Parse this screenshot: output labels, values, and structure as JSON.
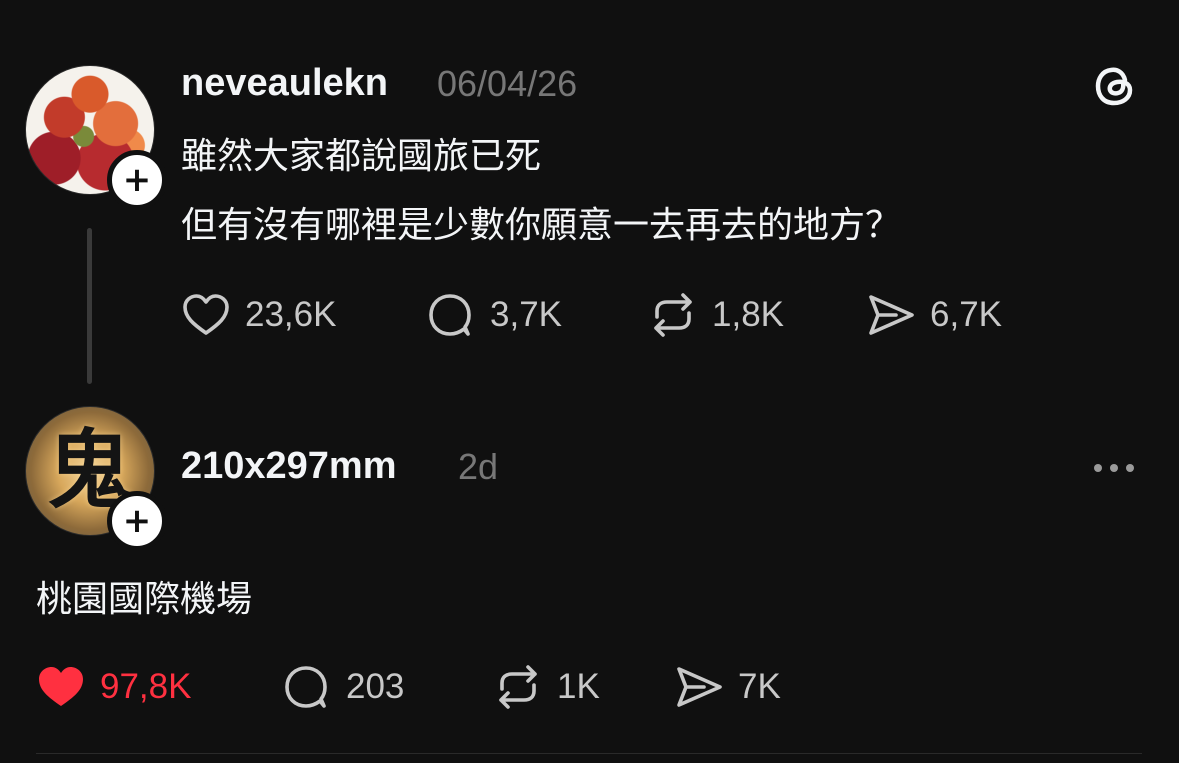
{
  "post1": {
    "username": "neveaulekn",
    "date": "06/04/26",
    "text_line1": "雖然大家都說國旅已死",
    "text_line2": "但有沒有哪裡是少數你願意一去再去的地方？",
    "actions": {
      "likes": "23,6K",
      "comments": "3,7K",
      "reposts": "1,8K",
      "shares": "6,7K"
    },
    "icons": [
      "threads-logo-icon",
      "plus-icon",
      "heart-icon",
      "comment-icon",
      "repost-icon",
      "share-icon"
    ]
  },
  "post2": {
    "username": "210x297mm",
    "time": "2d",
    "avatar_glyph": "鬼",
    "text": "桃園國際機場",
    "actions": {
      "likes": "97,8K",
      "comments": "203",
      "reposts": "1K",
      "shares": "7K"
    },
    "liked": true,
    "icons": [
      "plus-icon",
      "more-options-icon",
      "heart-filled-icon",
      "comment-icon",
      "repost-icon",
      "share-icon"
    ]
  },
  "colors": {
    "background": "#101010",
    "text": "#f3f5f7",
    "muted": "#777777",
    "like_active": "#ff3040"
  }
}
